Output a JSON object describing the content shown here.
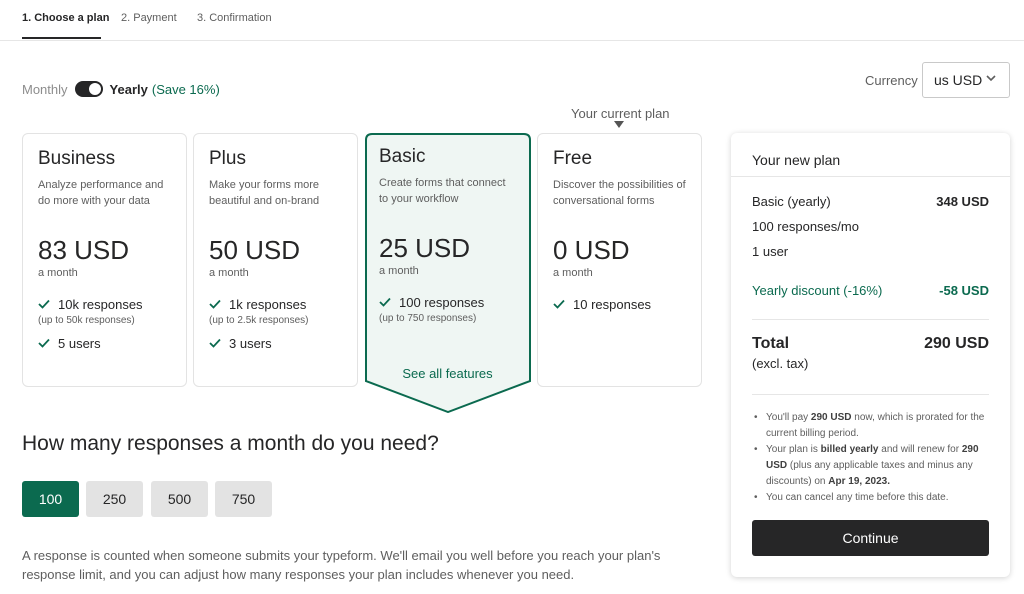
{
  "steps": [
    "1. Choose a plan",
    "2. Payment",
    "3. Confirmation"
  ],
  "billing": {
    "monthly": "Monthly",
    "yearly": "Yearly",
    "save": "(Save 16%)"
  },
  "currency": {
    "label": "Currency",
    "value": "us USD"
  },
  "current_plan_label": "Your current plan",
  "plans": {
    "business": {
      "name": "Business",
      "desc": "Analyze performance and do more with your data",
      "price": "83 USD",
      "period": "a month",
      "features": [
        {
          "text": "10k responses",
          "sub": "(up to 50k responses)"
        },
        {
          "text": "5 users",
          "sub": ""
        }
      ]
    },
    "plus": {
      "name": "Plus",
      "desc": "Make your forms more beautiful and on-brand",
      "price": "50 USD",
      "period": "a month",
      "features": [
        {
          "text": "1k responses",
          "sub": "(up to 2.5k responses)"
        },
        {
          "text": "3 users",
          "sub": ""
        }
      ]
    },
    "basic": {
      "name": "Basic",
      "desc": "Create forms that connect to your workflow",
      "price": "25 USD",
      "period": "a month",
      "features": [
        {
          "text": "100 responses",
          "sub": "(up to 750 responses)"
        }
      ],
      "see_all": "See all features"
    },
    "free": {
      "name": "Free",
      "desc": "Discover the possibilities of conversational forms",
      "price": "0 USD",
      "period": "a month",
      "features": [
        {
          "text": "10 responses",
          "sub": ""
        }
      ]
    }
  },
  "responses": {
    "title": "How many responses a month do you need?",
    "options": [
      "100",
      "250",
      "500",
      "750"
    ],
    "selected": "100",
    "note": "A response is counted when someone submits your typeform. We'll email you well before you reach your plan's response limit, and you can adjust how many responses your plan includes whenever you need."
  },
  "summary": {
    "title": "Your new plan",
    "plan_line": {
      "label": "Basic (yearly)",
      "value": "348 USD"
    },
    "responses_line": "100 responses/mo",
    "users_line": "1 user",
    "discount": {
      "label": "Yearly discount (-16%)",
      "value": "-58 USD"
    },
    "total": {
      "label": "Total",
      "sub": "(excl. tax)",
      "value": "290 USD"
    },
    "notes": {
      "n1_a": "You'll pay ",
      "n1_b": "290 USD",
      "n1_c": " now, which is prorated for the current billing period.",
      "n2_a": "Your plan is ",
      "n2_b": "billed yearly",
      "n2_c": " and will renew for ",
      "n2_d": "290 USD",
      "n2_e": " (plus any applicable taxes and minus any discounts) on ",
      "n2_f": "Apr 19, 2023.",
      "n3": "You can cancel any time before this date."
    },
    "continue": "Continue"
  },
  "colors": {
    "accent": "#0b6a4f",
    "dark": "#262627",
    "basic_bg": "#eff6f3"
  }
}
